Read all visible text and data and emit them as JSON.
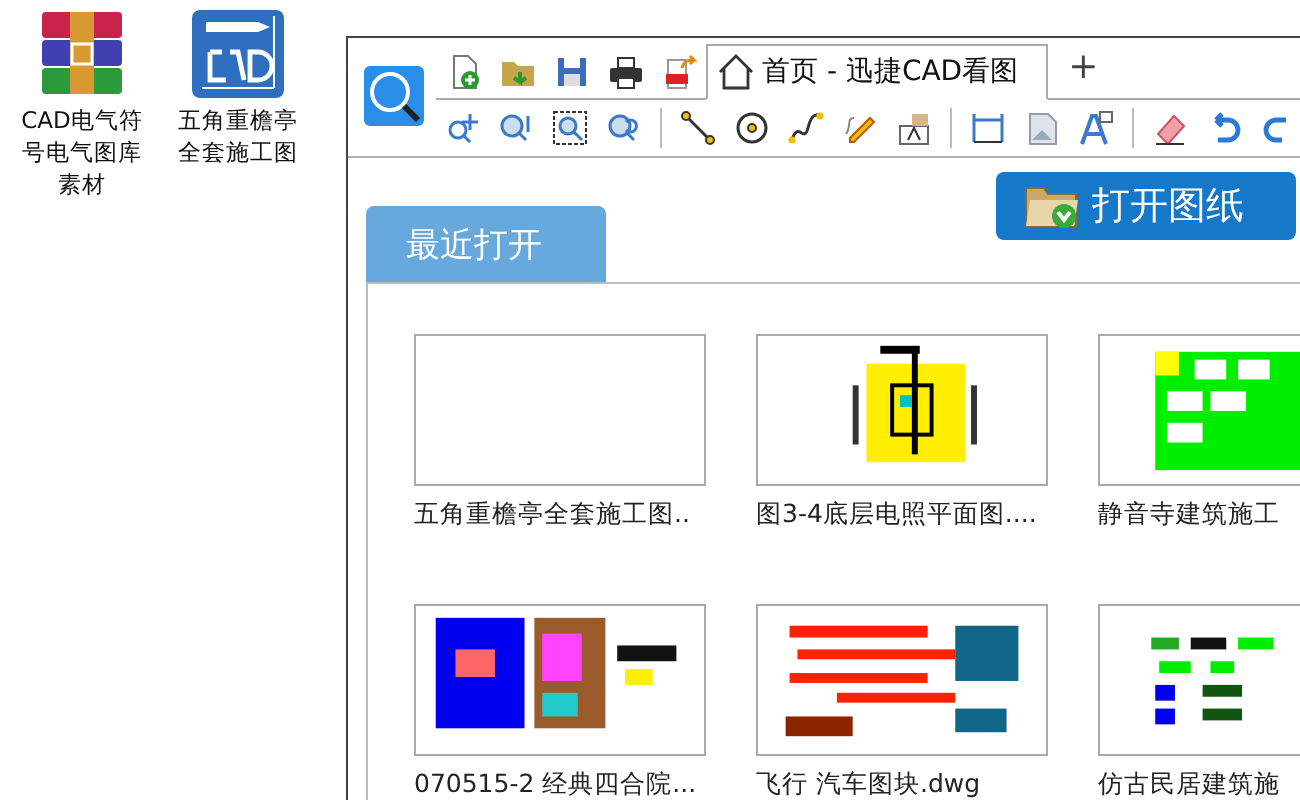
{
  "desktop_icons": [
    {
      "label": "CAD电气符号电气图库素材",
      "kind": "archive"
    },
    {
      "label": "五角重檐亭全套施工图",
      "kind": "cad"
    }
  ],
  "window": {
    "tabs": [
      {
        "label": "首页 - 迅捷CAD看图",
        "selected": true
      }
    ],
    "new_tab": "+"
  },
  "open_button": "打开图纸",
  "section_tab": "最近打开",
  "files": [
    {
      "name": "五角重檐亭全套施工图..",
      "preview": false
    },
    {
      "name": "图3-4底层电照平面图....",
      "preview": true
    },
    {
      "name": "静音寺建筑施工",
      "preview": true
    },
    {
      "name": "070515-2 经典四合院...",
      "preview": true
    },
    {
      "name": "飞行 汽车图块.dwg",
      "preview": true
    },
    {
      "name": "仿古民居建筑施",
      "preview": true
    }
  ]
}
